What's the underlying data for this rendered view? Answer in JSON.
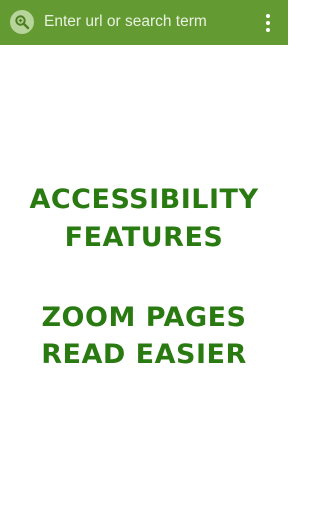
{
  "toolbar": {
    "search_icon": "magnifier-icon",
    "url_placeholder": "Enter url or search term",
    "menu_icon": "overflow-menu-icon"
  },
  "content": {
    "line1": "ACCESSIBILITY",
    "line2": "FEATURES",
    "line3": "ZOOM PAGES",
    "line4": "READ EASIER"
  },
  "colors": {
    "toolbar_bg": "#649a32",
    "headline_text": "#2a7a12",
    "page_bg": "#ffffff"
  }
}
